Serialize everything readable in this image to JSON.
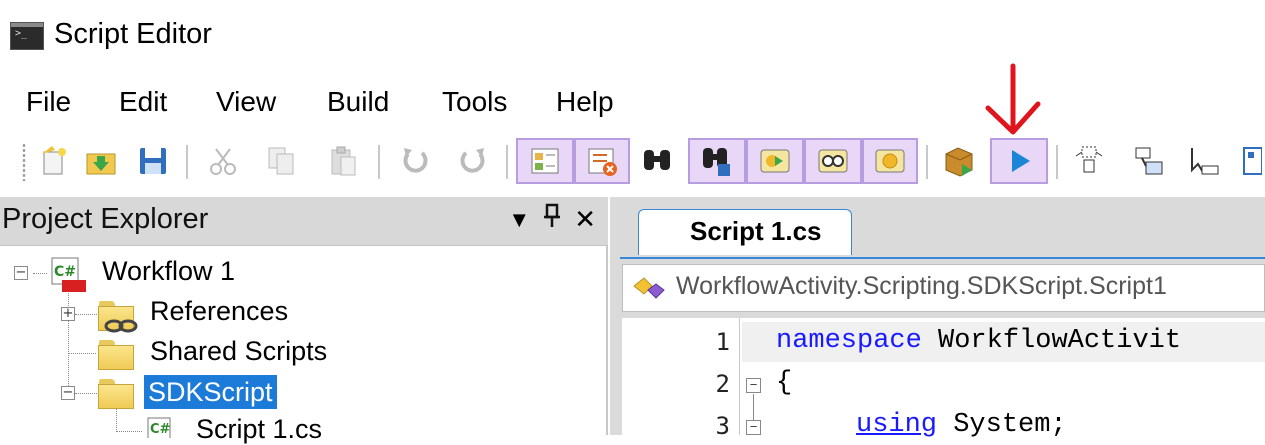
{
  "window": {
    "title": "Script Editor"
  },
  "menu": [
    "File",
    "Edit",
    "View",
    "Build",
    "Tools",
    "Help"
  ],
  "toolbar": {
    "buttons": [
      {
        "name": "new-script-icon"
      },
      {
        "name": "open-folder-icon"
      },
      {
        "name": "save-icon"
      },
      {
        "name": "cut-icon"
      },
      {
        "name": "copy-icon"
      },
      {
        "name": "paste-icon"
      },
      {
        "name": "undo-icon"
      },
      {
        "name": "redo-icon"
      },
      {
        "name": "properties-icon"
      },
      {
        "name": "remove-icon"
      },
      {
        "name": "find-icon"
      },
      {
        "name": "find-in-files-icon"
      },
      {
        "name": "start-debug-icon"
      },
      {
        "name": "watch-icon"
      },
      {
        "name": "breakpoint-icon"
      },
      {
        "name": "build-icon"
      },
      {
        "name": "run-icon"
      },
      {
        "name": "step-into-icon"
      },
      {
        "name": "step-over-icon"
      },
      {
        "name": "step-out-icon"
      }
    ],
    "highlight_color": "#e9d7f7"
  },
  "project_explorer": {
    "title": "Project Explorer",
    "controls": {
      "dropdown": "▾",
      "pin": "📌",
      "close": "✕"
    },
    "tree": {
      "root": "Workflow 1",
      "references": "References",
      "shared_scripts": "Shared Scripts",
      "sdk_script": "SDKScript",
      "script_file": "Script 1.cs"
    }
  },
  "editor": {
    "tab": "Script 1.cs",
    "nav_path": "WorkflowActivity.Scripting.SDKScript.Script1",
    "lines": [
      {
        "n": "1",
        "code_kw": "namespace",
        "code_rest": " WorkflowActivit"
      },
      {
        "n": "2",
        "code_kw": "",
        "code_rest": "{"
      },
      {
        "n": "3",
        "code_kw": "using",
        "code_rest": " System;"
      }
    ],
    "keyword_color": "#1a1aff"
  }
}
